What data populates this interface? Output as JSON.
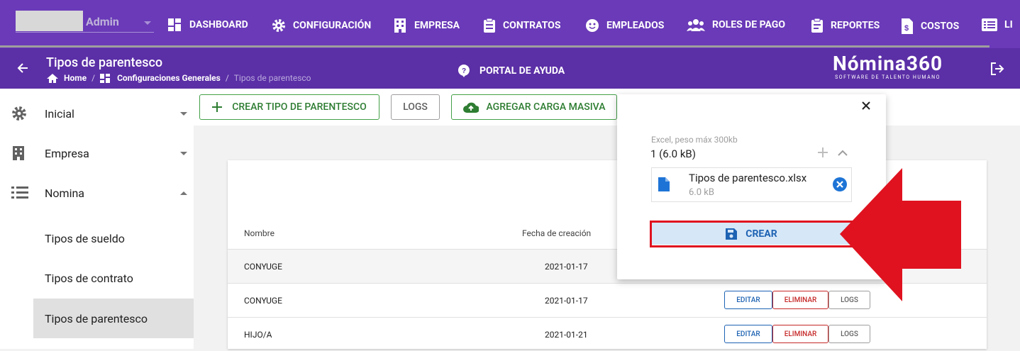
{
  "topbar": {
    "user": "Admin",
    "nav": [
      {
        "label": "DASHBOARD",
        "icon": "dashboard-icon"
      },
      {
        "label": "CONFIGURACIÓN",
        "icon": "gear-icon"
      },
      {
        "label": "EMPRESA",
        "icon": "building-icon"
      },
      {
        "label": "CONTRATOS",
        "icon": "clipboard-icon"
      },
      {
        "label": "EMPLEADOS",
        "icon": "face-icon"
      },
      {
        "label": "ROLES DE PAGO",
        "icon": "group-icon"
      },
      {
        "label": "REPORTES",
        "icon": "report-icon"
      },
      {
        "label": "COSTOS",
        "icon": "cost-icon"
      },
      {
        "label": "LI",
        "icon": "list-icon"
      }
    ],
    "progress": 0.97
  },
  "header": {
    "title": "Tipos de parentesco",
    "breadcrumb": [
      "Home",
      "Configuraciones Generales",
      "Tipos de parentesco"
    ],
    "help": "PORTAL DE AYUDA",
    "logo": "Nómina360",
    "logo_sub": "SOFTWARE DE TALENTO HUMANO"
  },
  "sidebar": {
    "items": [
      {
        "label": "Inicial",
        "icon": "gear-icon"
      },
      {
        "label": "Empresa",
        "icon": "building-icon"
      },
      {
        "label": "Nomina",
        "icon": "list-icon"
      }
    ],
    "subitems": [
      "Tipos de sueldo",
      "Tipos de contrato",
      "Tipos de parentesco"
    ]
  },
  "toolbar": {
    "create": "CREAR TIPO DE PARENTESCO",
    "logs": "LOGS",
    "bulk": "AGREGAR CARGA MASIVA"
  },
  "table": {
    "headers": [
      "Nombre",
      "Fecha de creación"
    ],
    "rows": [
      {
        "name": "CONYUGE",
        "date": "2021-01-17"
      },
      {
        "name": "CONYUGE",
        "date": "2021-01-17"
      },
      {
        "name": "HIJO/A",
        "date": "2021-01-21"
      }
    ],
    "actions": {
      "edit": "EDITAR",
      "delete": "ELIMINAR",
      "logs": "LOGS"
    }
  },
  "popup": {
    "hint": "Excel, peso máx 300kb",
    "count": "1 (6.0 kB)",
    "file_name": "Tipos de parentesco.xlsx",
    "file_size": "6.0 kB",
    "submit": "CREAR"
  },
  "colors": {
    "primary": "#6a3ab8",
    "annotation": "#e0121f"
  }
}
